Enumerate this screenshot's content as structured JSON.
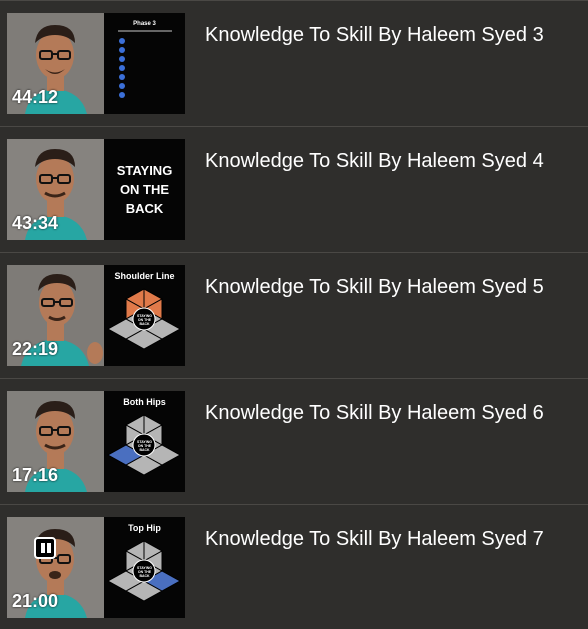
{
  "videos": [
    {
      "title": "Knowledge To Skill By Haleem Syed 3",
      "duration": "44:12",
      "slide": {
        "heading": "Phase 3"
      }
    },
    {
      "title": "Knowledge To Skill By Haleem Syed 4",
      "duration": "43:34",
      "slide": {
        "line1": "STAYING",
        "line2": "ON THE",
        "line3": "BACK"
      }
    },
    {
      "title": "Knowledge To Skill By Haleem Syed 5",
      "duration": "22:19",
      "slide": {
        "heading": "Shoulder Line",
        "hex_center": "STAYING ON THE BACK",
        "highlight_color": "#e07a4a"
      }
    },
    {
      "title": "Knowledge To Skill By Haleem Syed 6",
      "duration": "17:16",
      "slide": {
        "heading": "Both Hips",
        "hex_center": "STAYING ON THE BACK",
        "highlight_color": "#4a6fc0"
      }
    },
    {
      "title": "Knowledge To Skill By Haleem Syed 7",
      "duration": "21:00",
      "slide": {
        "heading": "Top Hip",
        "hex_center": "STAYING ON THE BACK",
        "highlight_color": "#4a6fc0"
      },
      "playing": true
    }
  ],
  "icons": {
    "pause": "pause-icon"
  },
  "colors": {
    "background": "#2f2e2c",
    "divider": "#4a4845",
    "dot": "#3b6fd8"
  }
}
